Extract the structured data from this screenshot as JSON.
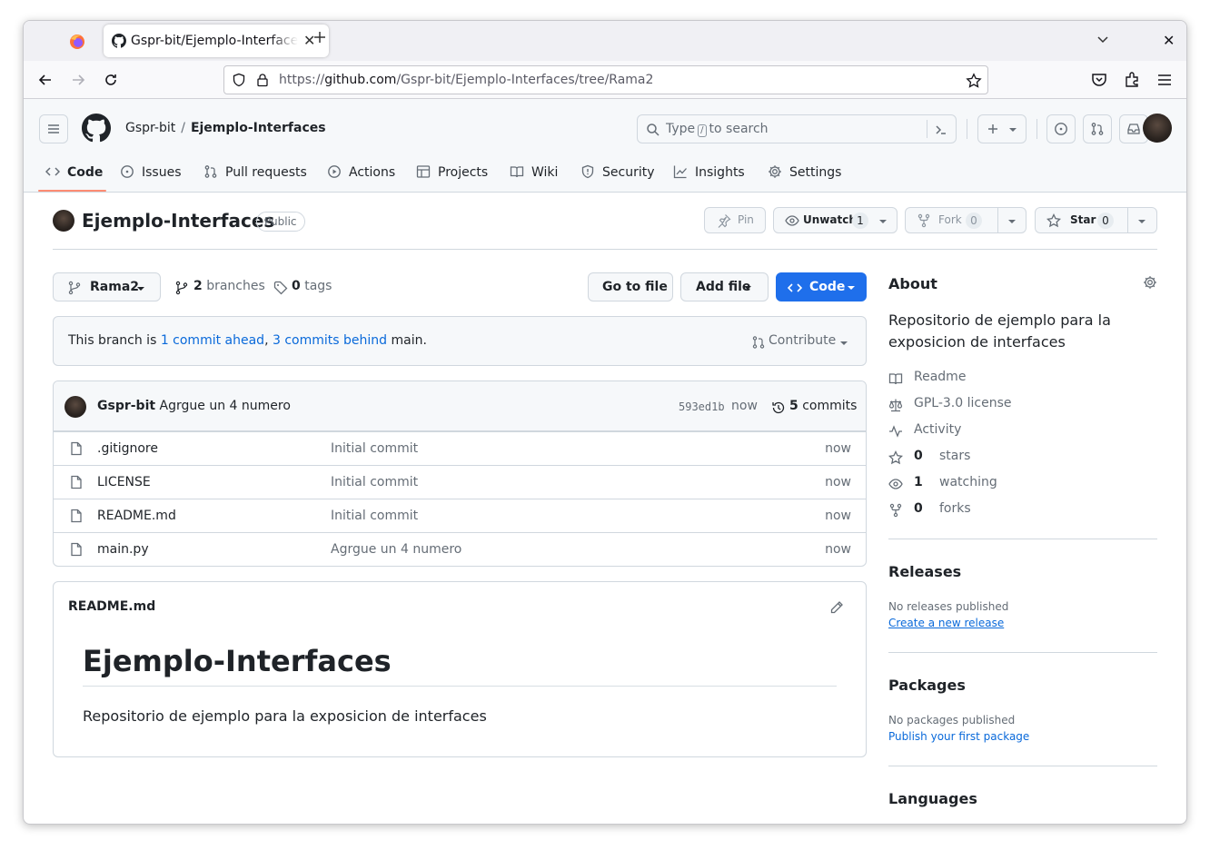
{
  "browser": {
    "tab_title": "Gspr-bit/Ejemplo-Interfaces",
    "url_prefix": "https://",
    "url_host": "github.com",
    "url_path": "/Gspr-bit/Ejemplo-Interfaces/tree/Rama2"
  },
  "header": {
    "owner": "Gspr-bit",
    "separator": "/",
    "repo": "Ejemplo-Interfaces",
    "search_pre": "Type",
    "search_key": "/",
    "search_post": "to search",
    "plus": "+"
  },
  "reponav": {
    "items": [
      {
        "label": "Code"
      },
      {
        "label": "Issues"
      },
      {
        "label": "Pull requests"
      },
      {
        "label": "Actions"
      },
      {
        "label": "Projects"
      },
      {
        "label": "Wiki"
      },
      {
        "label": "Security"
      },
      {
        "label": "Insights"
      },
      {
        "label": "Settings"
      }
    ]
  },
  "repohead": {
    "name": "Ejemplo-Interfaces",
    "visibility": "Public",
    "pin": "Pin",
    "unwatch": "Unwatch",
    "watch_count": "1",
    "fork": "Fork",
    "fork_count": "0",
    "star": "Star",
    "star_count": "0"
  },
  "toolbar": {
    "branch": "Rama2",
    "branches_count": "2",
    "branches_label": "branches",
    "tags_count": "0",
    "tags_label": "tags",
    "goto_file": "Go to file",
    "add_file": "Add file",
    "code": "Code"
  },
  "branch_status": {
    "prefix": "This branch is ",
    "ahead": "1 commit ahead",
    "comma": ", ",
    "behind": "3 commits behind",
    "suffix": " main.",
    "contribute": "Contribute"
  },
  "latest_commit": {
    "author": "Gspr-bit",
    "message": "Agrgue un 4 numero",
    "sha": "593ed1b",
    "when": "now",
    "commits_count": "5",
    "commits_label": "commits"
  },
  "files": [
    {
      "name": ".gitignore",
      "message": "Initial commit",
      "age": "now"
    },
    {
      "name": "LICENSE",
      "message": "Initial commit",
      "age": "now"
    },
    {
      "name": "README.md",
      "message": "Initial commit",
      "age": "now"
    },
    {
      "name": "main.py",
      "message": "Agrgue un 4 numero",
      "age": "now"
    }
  ],
  "readme": {
    "file": "README.md",
    "heading": "Ejemplo-Interfaces",
    "body": "Repositorio de ejemplo para la exposicion de interfaces"
  },
  "about": {
    "title": "About",
    "description": "Repositorio de ejemplo para la exposicion de interfaces",
    "readme": "Readme",
    "license": "GPL-3.0 license",
    "activity": "Activity",
    "stars_count": "0",
    "stars_label": "stars",
    "watching_count": "1",
    "watching_label": "watching",
    "forks_count": "0",
    "forks_label": "forks"
  },
  "releases": {
    "title": "Releases",
    "none": "No releases published",
    "create": "Create a new release"
  },
  "packages": {
    "title": "Packages",
    "none": "No packages published",
    "publish": "Publish your first package"
  },
  "languages": {
    "title": "Languages"
  },
  "colors": {
    "accent": "#0969da",
    "primary_button": "#1f6feb",
    "nav_underline": "#fd8c73"
  }
}
